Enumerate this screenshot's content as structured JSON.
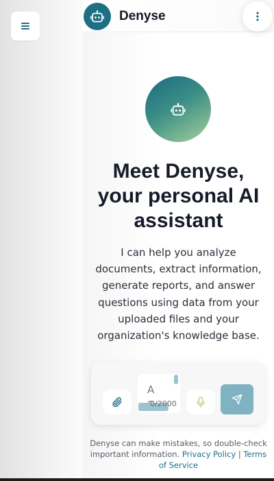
{
  "header": {
    "title": "Denyse"
  },
  "hero": {
    "title_line1": "Meet Denyse,",
    "title_line2": "your personal AI",
    "title_line3": "assistant",
    "description": "I can help you analyze documents, extract information, generate reports, and answer questions using data from your uploaded files and your organization's knowledge base."
  },
  "composer": {
    "input_value": "AS",
    "char_count": "0/2000",
    "send_enabled": false
  },
  "footer": {
    "disclaimer": "Denyse can make mistakes, so double-check important information.",
    "privacy_link": "Privacy Policy",
    "separator": "|",
    "terms_link": "Terms of Service"
  },
  "icons": {
    "menu": "hamburger-icon",
    "bot": "robot-icon",
    "more": "kebab-vertical-icon",
    "attach": "paperclip-icon",
    "mic": "microphone-icon",
    "send": "paper-plane-icon"
  },
  "colors": {
    "accent": "#1f6f84",
    "send_button": "#7fb3c2",
    "link": "#1d6f8a"
  }
}
